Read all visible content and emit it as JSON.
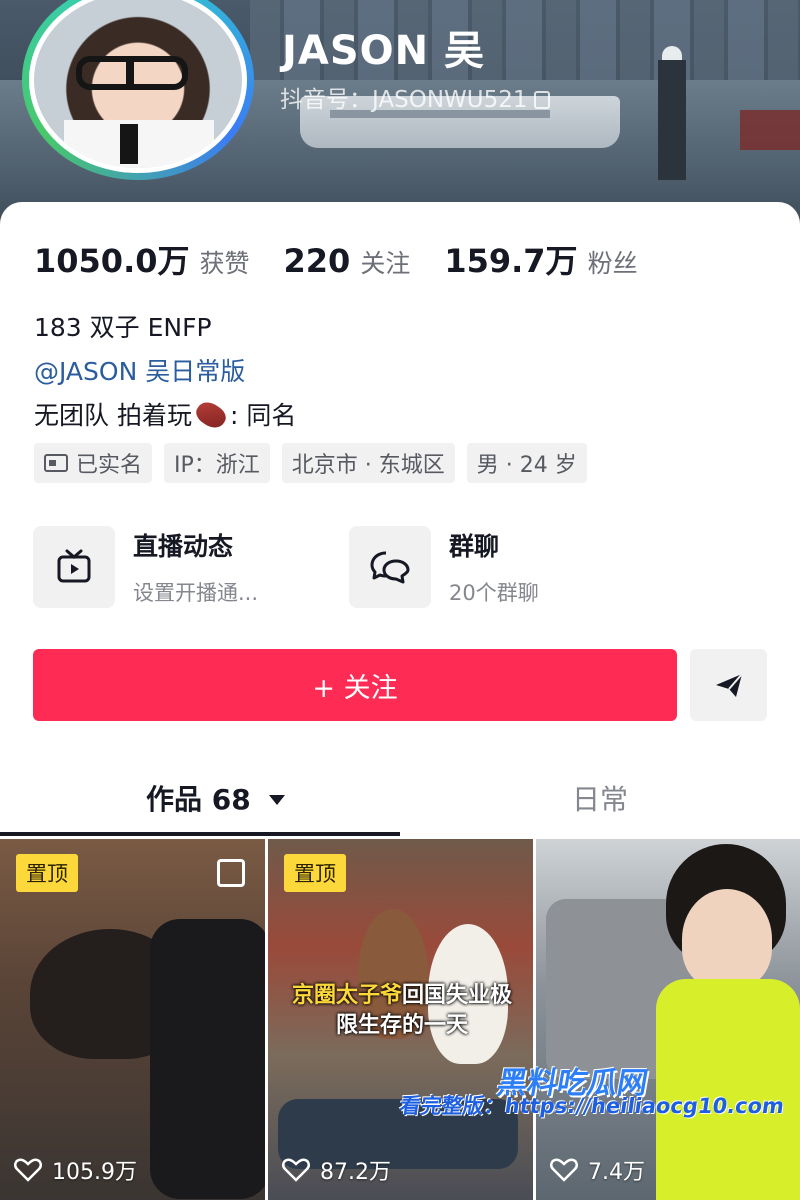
{
  "profile": {
    "name": "JASON 吴",
    "douyin_id": "抖音号：JASONWU521"
  },
  "stats": [
    {
      "num": "1050.0万",
      "label": "获赞"
    },
    {
      "num": "220",
      "label": "关注"
    },
    {
      "num": "159.7万",
      "label": "粉丝"
    }
  ],
  "bio": {
    "line1": "183 双子 ENFP",
    "link": "@JASON 吴日常版",
    "line3_before": "无团队 拍着玩",
    "line3_after": ": 同名"
  },
  "tags": [
    {
      "text": "已实名",
      "icon": "id-card-icon"
    },
    {
      "text": "IP：浙江"
    },
    {
      "text": "北京市 · 东城区"
    },
    {
      "text": "男 · 24 岁"
    }
  ],
  "features": [
    {
      "title": "直播动态",
      "sub": "设置开播通...",
      "icon": "live-tv-icon"
    },
    {
      "title": "群聊",
      "sub": "20个群聊",
      "icon": "group-chat-icon"
    }
  ],
  "actions": {
    "follow_label": "+ 关注",
    "share_icon": "send-icon"
  },
  "tabs": {
    "works_label": "作品 68",
    "daily_label": "日常"
  },
  "videos": [
    {
      "pinned": "置顶",
      "likes": "105.9万",
      "caption_hl": "",
      "caption": ""
    },
    {
      "pinned": "置顶",
      "likes": "87.2万",
      "caption_hl": "京圈太子爷",
      "caption": "回国失业极限生存的一天"
    },
    {
      "pinned": "",
      "likes": "7.4万",
      "caption_hl": "",
      "caption": ""
    }
  ],
  "watermark": {
    "line1": "黑料吃瓜网",
    "line2": "看完整版：https://heiliaocg10.com"
  },
  "colors": {
    "accent": "#fe2c55",
    "link": "#2b5d9e",
    "pin": "#fdd83a"
  }
}
